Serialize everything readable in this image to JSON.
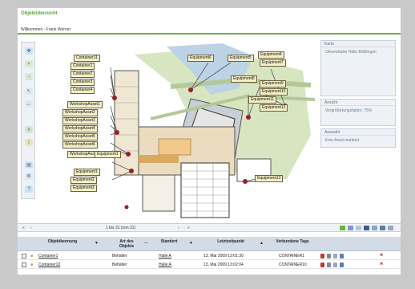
{
  "window": {
    "title": "Objektübersicht",
    "welcome": "Willkommen - Frank Werner"
  },
  "toolbar": {
    "tools": [
      "pan-icon",
      "zoom-in-icon",
      "zoom-out-icon",
      "select-icon",
      "measure-icon",
      "layers-icon",
      "info-icon",
      "print-icon",
      "settings-icon",
      "help-icon"
    ]
  },
  "map": {
    "callouts": [
      "Container11",
      "Container1",
      "Container2",
      "Container3",
      "Container4",
      "WorkshopAsset1",
      "WorkshopAsset2",
      "WorkshopAsset3",
      "WorkshopAsset4",
      "WorkshopAsset5",
      "WorkshopAsset6",
      "WorkshopAsset10",
      "Equipment1",
      "Equipment1",
      "Equipment2",
      "Equipment3",
      "Equipment6",
      "Equipment5",
      "Equipment4",
      "Equipment7",
      "Equipment8",
      "Equipment9",
      "Equipment10",
      "Equipment11",
      "Equipment12",
      "Equipment13"
    ]
  },
  "panels": {
    "karte": {
      "title": "Karte",
      "body": "Oliverstraße Halle Böblingen"
    },
    "ansicht": {
      "title": "Ansicht",
      "body": "Vergrößerungsfaktor: 75%"
    },
    "auswahl": {
      "title": "Auswahl",
      "body": "Kein Areal markiert"
    }
  },
  "pager": {
    "info": "1 bis 31 (von 31)"
  },
  "table": {
    "columns": [
      "Objektkennung",
      "Art des Objekts",
      "Standort",
      "Letztzeitpunkt",
      "Verbundene Tags"
    ],
    "rows": [
      {
        "id": "Container1",
        "type": "Behälter",
        "location": "Halle A",
        "time": "13. Mai 2009 13:01:30",
        "tags": "CONTAINER1"
      },
      {
        "id": "Container10",
        "type": "Behälter",
        "location": "Halle A",
        "time": "13. Mai 2009 13:02:04",
        "tags": "CONTAINER10"
      }
    ]
  },
  "colors": {
    "accent": "#6cb33f",
    "callout_bg": "#f4f0c4",
    "marker": "#9b1c2a",
    "panel_bg": "#eef2f7"
  }
}
